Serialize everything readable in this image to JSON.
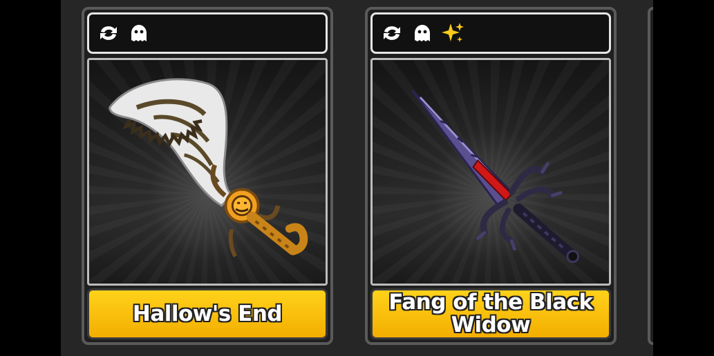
{
  "cards": [
    {
      "name": "Hallow's End",
      "icons": [
        "swap-arrows-icon",
        "ghost-icon"
      ]
    },
    {
      "name": "Fang of the Black Widow",
      "icons": [
        "swap-arrows-icon",
        "ghost-icon",
        "sparkles-icon"
      ]
    }
  ],
  "colors": {
    "panel": "#262626",
    "name_bar": "#f7b800",
    "sparkle": "#ffcc1a"
  }
}
